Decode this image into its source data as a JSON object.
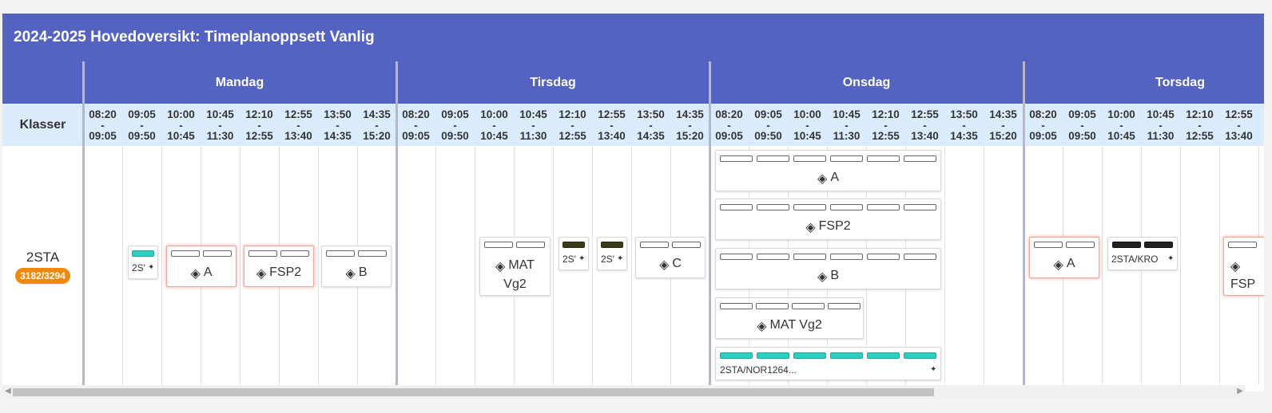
{
  "header": {
    "title": "2024-2025 Hovedoversikt: Timeplanoppsett Vanlig"
  },
  "days": [
    "Mandag",
    "Tirsdag",
    "Onsdag",
    "Torsdag"
  ],
  "klasser_label": "Klasser",
  "slots": [
    {
      "start": "08:20",
      "sep": "-",
      "end": "09:05"
    },
    {
      "start": "09:05",
      "sep": "-",
      "end": "09:50"
    },
    {
      "start": "10:00",
      "sep": "-",
      "end": "10:45"
    },
    {
      "start": "10:45",
      "sep": "-",
      "end": "11:30"
    },
    {
      "start": "12:10",
      "sep": "-",
      "end": "12:55"
    },
    {
      "start": "12:55",
      "sep": "-",
      "end": "13:40"
    },
    {
      "start": "13:50",
      "sep": "-",
      "end": "14:35"
    },
    {
      "start": "14:35",
      "sep": "-",
      "end": "15:20"
    }
  ],
  "class": {
    "name": "2STA",
    "count": "3182/3294"
  },
  "cards": {
    "mon_small": "2S'",
    "mon_a": "A",
    "mon_fsp2": "FSP2",
    "mon_b": "B",
    "tue_mat": "MAT Vg2",
    "tue_small1": "2S'",
    "tue_small2": "2S'",
    "tue_c": "C",
    "wed_a": "A",
    "wed_fsp2": "FSP2",
    "wed_b": "B",
    "wed_mat": "MAT Vg2",
    "wed_nor": "2STA/NOR1264...",
    "thu_a": "A",
    "thu_kro": "2STA/KRO",
    "thu_fsp": "FSP"
  },
  "colors": {
    "header": "#5563c0",
    "timerow": "#dcecff",
    "badge": "#f0880c",
    "teal": "#2ccfc2"
  },
  "icons": {
    "stack": "layers-icon",
    "pin": "pin-icon"
  }
}
